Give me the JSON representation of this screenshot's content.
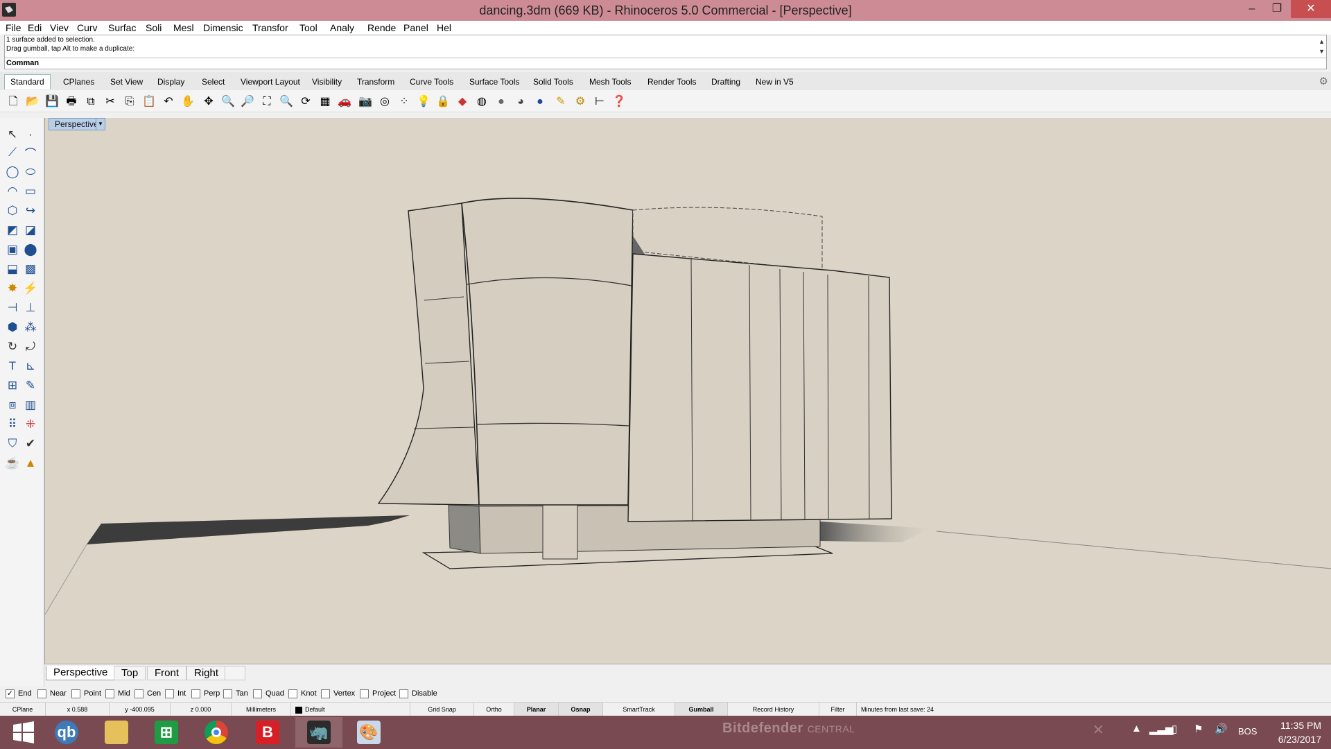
{
  "window": {
    "title": "dancing.3dm (669 KB) - Rhinoceros 5.0 Commercial - [Perspective]",
    "minimize": "–",
    "maximize": "❐",
    "close": "✕"
  },
  "menu": [
    "File",
    "Edi",
    "Viev",
    "Curv",
    "Surfac",
    "Soli",
    "Mesl",
    "Dimensic",
    "Transfor",
    "Tool",
    "Analy",
    "Rende",
    "Panel",
    "Hel"
  ],
  "command": {
    "history": [
      "1 surface added to selection.",
      "Drag gumball, tap Alt to make a duplicate:"
    ],
    "prompt": "Comman"
  },
  "tabs": [
    "Standard",
    "CPlanes",
    "Set View",
    "Display",
    "Select",
    "Viewport Layout",
    "Visibility",
    "Transform",
    "Curve Tools",
    "Surface Tools",
    "Solid Tools",
    "Mesh Tools",
    "Render Tools",
    "Drafting",
    "New in V5"
  ],
  "active_tab": "Standard",
  "toolbar_icons": [
    "new-file-icon",
    "open-folder-icon",
    "save-icon",
    "print-icon",
    "import-icon",
    "cut-icon",
    "copy-icon",
    "paste-icon",
    "undo-icon",
    "pan-hand-icon",
    "move-view-icon",
    "zoom-window-icon",
    "zoom-dynamic-icon",
    "zoom-extents-icon",
    "zoom-selected-icon",
    "rotate-view-icon",
    "four-viewports-icon",
    "car-render-icon",
    "camera-icon",
    "circle-target-icon",
    "point-filter-icon",
    "light-bulb-icon",
    "lock-icon",
    "layer-icon",
    "color-wheel-icon",
    "sphere-shaded-icon",
    "sphere-rendered-icon",
    "sphere-blue-icon",
    "pen-highlight-icon",
    "gear-settings-icon",
    "dimension-icon",
    "help-icon"
  ],
  "viewport": {
    "label": "Perspective",
    "dropdown": "▼"
  },
  "viewport_tabs": [
    "Perspective",
    "Top",
    "Front",
    "Right"
  ],
  "active_viewport_tab": "Perspective",
  "osnap": [
    {
      "label": "End",
      "checked": true
    },
    {
      "label": "Near",
      "checked": false
    },
    {
      "label": "Point",
      "checked": false
    },
    {
      "label": "Mid",
      "checked": false
    },
    {
      "label": "Cen",
      "checked": false
    },
    {
      "label": "Int",
      "checked": false
    },
    {
      "label": "Perp",
      "checked": false
    },
    {
      "label": "Tan",
      "checked": false
    },
    {
      "label": "Quad",
      "checked": false
    },
    {
      "label": "Knot",
      "checked": false
    },
    {
      "label": "Vertex",
      "checked": false
    },
    {
      "label": "Project",
      "checked": false
    },
    {
      "label": "Disable",
      "checked": false
    }
  ],
  "status": {
    "cplane": "CPlane",
    "x": "x 0.588",
    "y": "y -400.095",
    "z": "z 0.000",
    "units": "Millimeters",
    "layer": "Default",
    "grid_snap": "Grid Snap",
    "ortho": "Ortho",
    "planar": "Planar",
    "osnap": "Osnap",
    "smarttrack": "SmartTrack",
    "gumball": "Gumball",
    "record_history": "Record History",
    "filter": "Filter",
    "last_save": "Minutes from last save: 24"
  },
  "taskbar": {
    "bitdefender": "Bitdefender",
    "bitdefender_sub": "CENTRAL",
    "lang": "BOS",
    "time": "11:35 PM",
    "date": "6/23/2017"
  },
  "colors": {
    "titlebar": "#cd8c95",
    "viewport_bg": "#dbd4c7",
    "taskbar": "#7a4a52"
  }
}
